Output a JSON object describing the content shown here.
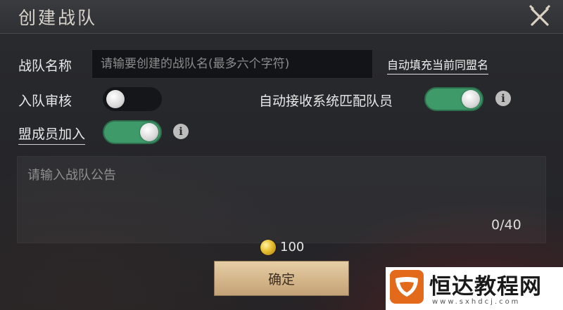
{
  "header": {
    "title": "创建战队",
    "close_icon": "close-crossed-swords-icon"
  },
  "form": {
    "name_label": "战队名称",
    "name_placeholder": "请输要创建的战队名(最多六个字符)",
    "name_value": "",
    "autofill_link": "自动填充当前同盟名",
    "review_label": "入队审核",
    "review_toggle_on": false,
    "auto_accept_label": "自动接收系统匹配队员",
    "auto_accept_on": true,
    "alliance_join_label": "盟成员加入",
    "alliance_join_on": true,
    "info_icon_glyph": "i",
    "notice_placeholder": "请输入战队公告",
    "notice_counter": "0/40"
  },
  "cost": {
    "icon": "gold-coin-icon",
    "amount": "100"
  },
  "actions": {
    "confirm_label": "确定"
  },
  "watermark": {
    "text": "恒达教程网",
    "url": "www.sxhdcj.com"
  },
  "colors": {
    "toggle_on": "#3f9a6a",
    "toggle_off": "#15161a",
    "confirm_button": "#d4b58a",
    "watermark_logo": "#e46a1b"
  }
}
